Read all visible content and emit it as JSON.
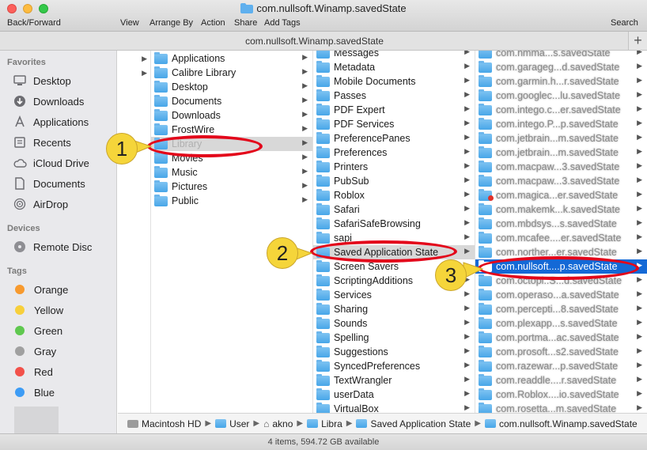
{
  "window": {
    "title": "com.nullsoft.Winamp.savedState",
    "path_title": "com.nullsoft.Winamp.savedState",
    "plus": "+"
  },
  "toolbar": {
    "back_forward": "Back/Forward",
    "view": "View",
    "arrange_by": "Arrange By",
    "action": "Action",
    "share": "Share",
    "add_tags": "Add Tags",
    "search": "Search"
  },
  "sidebar": {
    "favorites_heading": "Favorites",
    "favorites": [
      {
        "label": "Desktop",
        "icon": "desktop-icon"
      },
      {
        "label": "Downloads",
        "icon": "downloads-icon"
      },
      {
        "label": "Applications",
        "icon": "applications-icon"
      },
      {
        "label": "Recents",
        "icon": "recents-icon"
      },
      {
        "label": "iCloud Drive",
        "icon": "cloud-icon"
      },
      {
        "label": "Documents",
        "icon": "documents-icon"
      },
      {
        "label": "AirDrop",
        "icon": "airdrop-icon"
      }
    ],
    "devices_heading": "Devices",
    "devices": [
      {
        "label": "Remote Disc",
        "icon": "disc-icon"
      }
    ],
    "tags_heading": "Tags",
    "tags": [
      {
        "label": "Orange",
        "color": "#f79a2e"
      },
      {
        "label": "Yellow",
        "color": "#f7cf3b"
      },
      {
        "label": "Green",
        "color": "#5fc84f"
      },
      {
        "label": "Gray",
        "color": "#a0a0a0"
      },
      {
        "label": "Red",
        "color": "#f2514a"
      },
      {
        "label": "Blue",
        "color": "#3d9cf5"
      }
    ]
  },
  "column2": [
    {
      "label": "Applications"
    },
    {
      "label": "Calibre Library"
    },
    {
      "label": "Desktop"
    },
    {
      "label": "Documents"
    },
    {
      "label": "Downloads"
    },
    {
      "label": "FrostWire"
    },
    {
      "label": "Library"
    },
    {
      "label": "Movies"
    },
    {
      "label": "Music"
    },
    {
      "label": "Pictures"
    },
    {
      "label": "Public"
    }
  ],
  "column3": [
    {
      "label": "Messages"
    },
    {
      "label": "Metadata"
    },
    {
      "label": "Mobile Documents"
    },
    {
      "label": "Passes"
    },
    {
      "label": "PDF Expert"
    },
    {
      "label": "PDF Services"
    },
    {
      "label": "PreferencePanes"
    },
    {
      "label": "Preferences"
    },
    {
      "label": "Printers"
    },
    {
      "label": "PubSub"
    },
    {
      "label": "Roblox"
    },
    {
      "label": "Safari"
    },
    {
      "label": "SafariSafeBrowsing"
    },
    {
      "label": "sapi"
    },
    {
      "label": "Saved Application State"
    },
    {
      "label": "Screen Savers"
    },
    {
      "label": "ScriptingAdditions"
    },
    {
      "label": "Services"
    },
    {
      "label": "Sharing"
    },
    {
      "label": "Sounds"
    },
    {
      "label": "Spelling"
    },
    {
      "label": "Suggestions"
    },
    {
      "label": "SyncedPreferences"
    },
    {
      "label": "TextWrangler"
    },
    {
      "label": "userData"
    },
    {
      "label": "VirtualBox"
    }
  ],
  "column4": [
    {
      "label": "com.hmma...s.savedState"
    },
    {
      "label": "com.garageg...d.savedState"
    },
    {
      "label": "com.garmin.h...r.savedState"
    },
    {
      "label": "com.googlec...lu.savedState"
    },
    {
      "label": "com.intego.c...er.savedState"
    },
    {
      "label": "com.intego.P...p.savedState"
    },
    {
      "label": "com.jetbrain...m.savedState"
    },
    {
      "label": "com.jetbrain...m.savedState"
    },
    {
      "label": "com.macpaw...3.savedState"
    },
    {
      "label": "com.macpaw...3.savedState"
    },
    {
      "label": "com.magica...er.savedState"
    },
    {
      "label": "com.makemk...k.savedState"
    },
    {
      "label": "com.mbdsys...s.savedState"
    },
    {
      "label": "com.mcafee....er.savedState"
    },
    {
      "label": "com.norther...er.savedState"
    },
    {
      "label": "com.nullsoft....p.savedState"
    },
    {
      "label": "com.octopi..S...d.savedState"
    },
    {
      "label": "com.operaso...a.savedState"
    },
    {
      "label": "com.percepti...8.savedState"
    },
    {
      "label": "com.plexapp...s.savedState"
    },
    {
      "label": "com.portma...ac.savedState"
    },
    {
      "label": "com.prosoft...s2.savedState"
    },
    {
      "label": "com.razewar...p.savedState"
    },
    {
      "label": "com.readdle....r.savedState"
    },
    {
      "label": "com.Roblox....io.savedState"
    },
    {
      "label": "com.rosetta...m.savedState"
    }
  ],
  "pathbar": {
    "disk": "Macintosh HD",
    "users": "User",
    "home": "akno",
    "library": "Libra",
    "saved_state": "Saved Application State",
    "current": "com.nullsoft.Winamp.savedState"
  },
  "status": {
    "text": "4 items, 594.72 GB available"
  },
  "annotations": {
    "step1": "1",
    "step2": "2",
    "step3": "3",
    "color_oval": "#e3061a",
    "color_badge": "#f5d53a"
  }
}
